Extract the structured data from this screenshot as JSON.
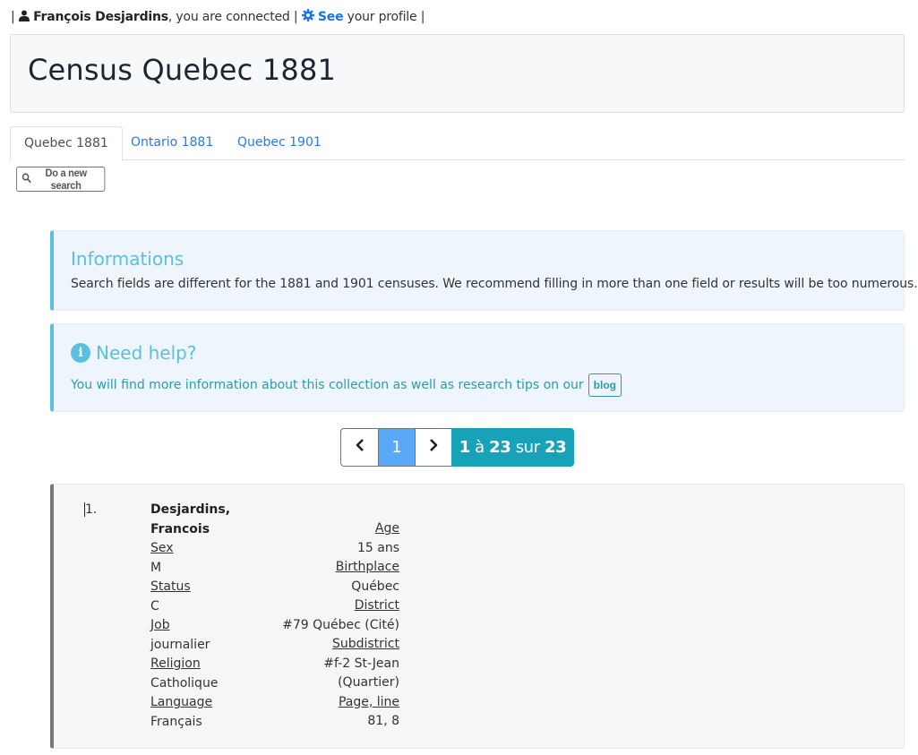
{
  "topbar": {
    "user_name": "François Desjardins",
    "connected_text": ", you are connected",
    "see_link": "See",
    "profile_text": " your profile",
    "separator": "|"
  },
  "header": {
    "title": "Census Quebec 1881"
  },
  "tabs": [
    {
      "label": "Quebec 1881",
      "active": true
    },
    {
      "label": "Ontario 1881",
      "active": false
    },
    {
      "label": "Quebec 1901",
      "active": false
    }
  ],
  "new_search_button": "Do a new search",
  "info_alert": {
    "title": "Informations",
    "text": "Search fields are different for the 1881 and 1901 censuses. We recommend filling in more than one field or results will be too numerous."
  },
  "help_alert": {
    "title": "Need help?",
    "text": "You will find more information about this collection as well as research tips on our",
    "blog_button": "blog"
  },
  "pagination": {
    "prev_icon": "‹",
    "current_page": "1",
    "next_icon": "›",
    "range_start": "1",
    "range_word": "à",
    "range_end": "23",
    "of_word": "sur",
    "total": "23"
  },
  "result": {
    "index": "1.",
    "surname": "Desjardins,",
    "given_name": "Francois",
    "left_fields": [
      {
        "label": "Sex",
        "value": "M"
      },
      {
        "label": "Status",
        "value": "C"
      },
      {
        "label": "Job",
        "value": "journalier"
      },
      {
        "label": "Religion",
        "value": "Catholique"
      },
      {
        "label": "Language",
        "value": "Français"
      }
    ],
    "right_fields": [
      {
        "label": "Age",
        "value": "15 ans"
      },
      {
        "label": "Birthplace",
        "value": "Québec"
      },
      {
        "label": "District",
        "value": "#79 Québec (Cité)"
      },
      {
        "label": "Subdistrict",
        "value": "#f-2 St-Jean",
        "value2": "(Quartier)"
      },
      {
        "label": "Page, line",
        "value": "81, 8"
      }
    ]
  },
  "colors": {
    "accent_blue": "#2a7ae2",
    "info": "#5bc0de",
    "teal": "#17a2b8",
    "page_active": "#5aa9f8"
  }
}
